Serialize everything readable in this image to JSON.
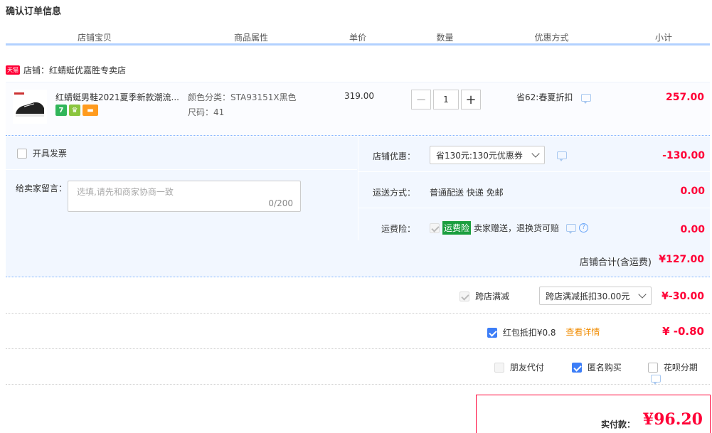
{
  "page": {
    "title": "确认订单信息"
  },
  "columns": [
    "店铺宝贝",
    "商品属性",
    "单价",
    "数量",
    "优惠方式",
    "小计"
  ],
  "shop": {
    "badge": "天猫",
    "name": "店铺：红蜻蜓优嘉胜专卖店"
  },
  "item": {
    "name": "红蜻蜓男鞋2021夏季新款潮流...",
    "badges": [
      {
        "text": "7",
        "color": "#30b55a"
      },
      {
        "text": "♛",
        "color": "#8ac53e"
      },
      {
        "text": "▬",
        "color": "#ff9b1e"
      }
    ],
    "attr_color": "颜色分类：STA93151X黑色",
    "attr_size": "尺码：41",
    "unit_price": "319.00",
    "quantity": "1",
    "qty_minus": "−",
    "qty_plus": "+",
    "promo": "省62:春夏折扣",
    "subtotal": "257.00"
  },
  "invoice": {
    "label": "开具发票"
  },
  "message": {
    "label": "给卖家留言：",
    "placeholder": "选填,请先和商家协商一致",
    "count": "0/200"
  },
  "shop_discount": {
    "label": "店铺优惠：",
    "selected": "省130元:130元优惠券",
    "amount": "-130.00"
  },
  "shipping": {
    "label": "运送方式：",
    "value": "普通配送 快递 免邮",
    "amount": "0.00"
  },
  "insurance": {
    "label": "运费险：",
    "tag": "运费险",
    "text": "卖家赠送，退换货可赔",
    "help": "?",
    "amount": "0.00"
  },
  "shop_total": {
    "label": "店铺合计(含运费)",
    "amount": "¥127.00"
  },
  "cross_store": {
    "label": "跨店满减",
    "selected": "跨店满减抵扣30.00元",
    "amount": "¥-30.00"
  },
  "red_packet": {
    "label": "红包抵扣¥0.8",
    "link": "查看详情",
    "amount": "¥ -0.80"
  },
  "options": {
    "friend_pay": "朋友代付",
    "anonymous": "匿名购买",
    "huabei": "花呗分期"
  },
  "payment": {
    "label": "实付款：",
    "amount": "¥96.20"
  },
  "colors": {
    "accent": "#ff0036",
    "blue_border": "#b2d1ff",
    "panel": "#f2f7ff",
    "check": "#3d7ef7"
  }
}
